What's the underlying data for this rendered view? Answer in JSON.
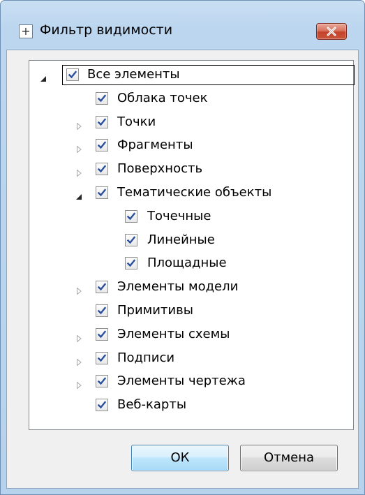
{
  "window": {
    "title": "Фильтр видимости",
    "icon": "plus-box-icon",
    "close_icon": "close-x-icon",
    "close_color": "#c4432a"
  },
  "tree": {
    "items": [
      {
        "label": "Все элементы",
        "checked": true,
        "expander": "expanded",
        "level": 0,
        "focused": true
      },
      {
        "label": "Облака точек",
        "checked": true,
        "expander": "none",
        "level": 1
      },
      {
        "label": "Точки",
        "checked": true,
        "expander": "collapsed",
        "level": 1
      },
      {
        "label": "Фрагменты",
        "checked": true,
        "expander": "collapsed",
        "level": 1
      },
      {
        "label": "Поверхность",
        "checked": true,
        "expander": "collapsed",
        "level": 1
      },
      {
        "label": "Тематические объекты",
        "checked": true,
        "expander": "expanded",
        "level": 1
      },
      {
        "label": "Точечные",
        "checked": true,
        "expander": "none",
        "level": 2
      },
      {
        "label": "Линейные",
        "checked": true,
        "expander": "none",
        "level": 2
      },
      {
        "label": "Площадные",
        "checked": true,
        "expander": "none",
        "level": 2
      },
      {
        "label": "Элементы модели",
        "checked": true,
        "expander": "collapsed",
        "level": 1
      },
      {
        "label": "Примитивы",
        "checked": true,
        "expander": "none",
        "level": 1
      },
      {
        "label": "Элементы схемы",
        "checked": true,
        "expander": "collapsed",
        "level": 1
      },
      {
        "label": "Подписи",
        "checked": true,
        "expander": "collapsed",
        "level": 1
      },
      {
        "label": "Элементы чертежа",
        "checked": true,
        "expander": "collapsed",
        "level": 1
      },
      {
        "label": "Веб-карты",
        "checked": true,
        "expander": "none",
        "level": 1
      }
    ]
  },
  "buttons": {
    "ok_label": "ОК",
    "cancel_label": "Отмена"
  },
  "colors": {
    "checkmark": "#2a4f9e",
    "ok_border": "#3c7fb1"
  }
}
